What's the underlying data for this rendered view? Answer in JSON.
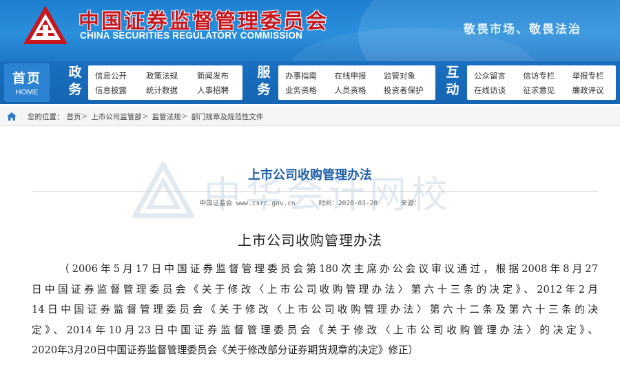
{
  "header": {
    "title_cn": "中国证券监督管理委员会",
    "title_en": "CHINA SECURITIES REGULATORY COMMISSION",
    "slogan": "敬畏市场、敬畏法治",
    "logo_icon": "csrc-logo-icon",
    "colors": {
      "banner": "#2a8fdc",
      "title_red": "#c8161d",
      "nav": "#1565b3"
    }
  },
  "nav": {
    "home_cn": "首页",
    "home_en": "HOME",
    "sections": [
      {
        "head": "政务",
        "links": [
          "信息公开",
          "政策法规",
          "新闻发布",
          "信息披露",
          "统计数据",
          "人事招聘"
        ]
      },
      {
        "head": "服务",
        "links": [
          "办事指南",
          "在线申报",
          "监管对象",
          "业务资格",
          "人员资格",
          "投资者保护"
        ]
      },
      {
        "head": "互动",
        "links": [
          "公众留言",
          "信访专栏",
          "举报专栏",
          "在线访谈",
          "征求意见",
          "廉政评议"
        ]
      }
    ]
  },
  "breadcrumb": {
    "prefix": "您的位置：",
    "items": [
      "首页",
      "上市公司监管部",
      "监管法规",
      "部门规章及规范性文件"
    ],
    "separator": ">",
    "home_icon": "home-icon"
  },
  "watermark": {
    "text": "中华会计网校",
    "icon": "watermark-logo-icon"
  },
  "article": {
    "title": "上市公司收购管理办法",
    "source": "中国证监会 www.csrc.gov.cn",
    "time": "时间：2020-03-20",
    "origin": "来源：",
    "doc_title": "上市公司收购管理办法",
    "body_lines": [
      "（2006年5月17日中国证券监督管理委员会第180次主席办公会议审议通过，根据2008年8月27",
      "日中国证券监督管理委员会《关于修改〈上市公司收购管理办法〉第六十三条的决定》、2012年2月",
      "14日中国证券监督管理委员会《关于修改〈上市公司收购管理办法〉第六十二条及第六十三条的决",
      "定》、2014年10月23日中国证券监督管理委员会《关于修改〈上市公司收购管理办法〉的决定》、",
      "2020年3月20日中国证券监督管理委员会《关于修改部分证券期货规章的决定》修正）"
    ]
  }
}
